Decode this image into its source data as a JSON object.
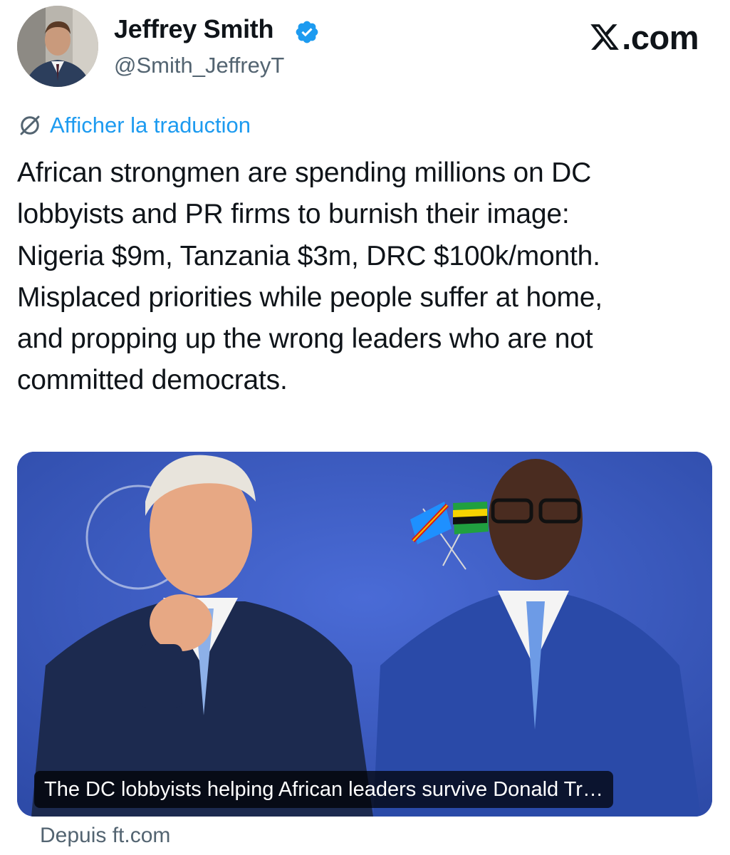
{
  "author": {
    "display_name": "Jeffrey Smith",
    "handle": "@Smith_JeffreyT",
    "verified": true,
    "avatar_icon": "profile-photo"
  },
  "brand": {
    "logo_text": ".com",
    "logo_icon": "x-logo-icon"
  },
  "translate": {
    "label": "Afficher la traduction",
    "icon": "globe-slash-icon"
  },
  "tweet": {
    "lines": [
      "African strongmen are spending millions on DC",
      "lobbyists and PR firms to burnish their image:",
      "Nigeria $9m, Tanzania $3m, DRC $100k/month.",
      "Misplaced priorities while people suffer at home,",
      "and propping up the wrong leaders who are not",
      "committed democrats."
    ]
  },
  "link_card": {
    "caption": "The DC lobbyists helping African leaders survive Donald Tr…",
    "source": "Depuis ft.com"
  },
  "colors": {
    "text": "#0f1419",
    "secondary": "#536471",
    "accent": "#1d9bf0",
    "verified": "#1d9bf0",
    "photo_background": "#3b5cc6"
  }
}
